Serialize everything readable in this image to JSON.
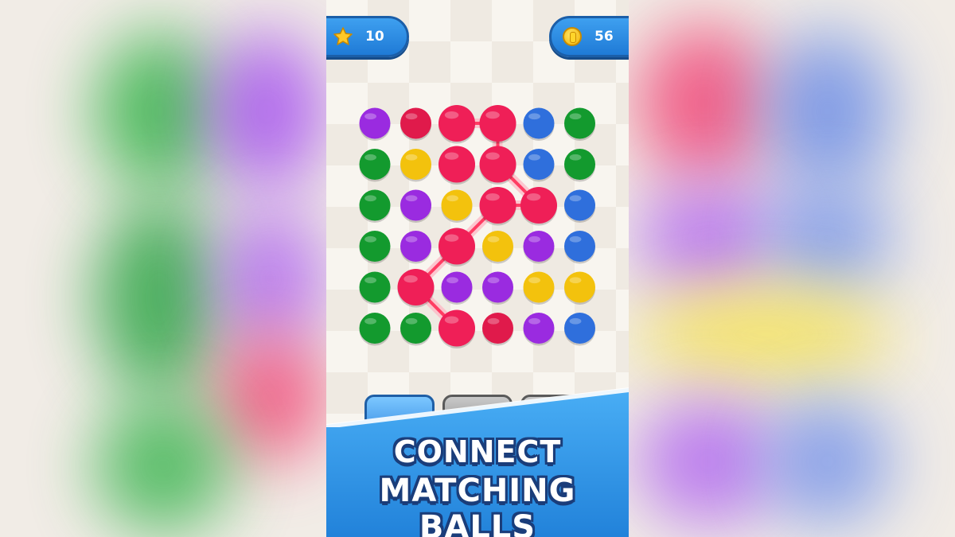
{
  "hud": {
    "stars": "10",
    "coins": "56"
  },
  "headline": {
    "line1": "CONNECT",
    "line2": "MATCHING BALLS"
  },
  "colors": {
    "purple": "#9a2be0",
    "red": "#e01a4b",
    "pink": "#ef1f57",
    "blue": "#2f6fdc",
    "green": "#139a2e",
    "yellow": "#f3c20d",
    "link": "#ff3d63"
  },
  "board": {
    "rows": [
      [
        "purple",
        "red",
        "pink",
        "pink",
        "blue",
        "green"
      ],
      [
        "green",
        "yellow",
        "pink",
        "pink",
        "blue",
        "green"
      ],
      [
        "green",
        "purple",
        "yellow",
        "pink",
        "pink",
        "blue"
      ],
      [
        "green",
        "purple",
        "pink",
        "yellow",
        "purple",
        "blue"
      ],
      [
        "green",
        "pink",
        "purple",
        "purple",
        "yellow",
        "yellow"
      ],
      [
        "green",
        "green",
        "pink",
        "red",
        "purple",
        "blue"
      ]
    ],
    "path": [
      [
        0,
        2
      ],
      [
        0,
        3
      ],
      [
        1,
        3
      ],
      [
        2,
        4
      ],
      [
        2,
        3
      ],
      [
        3,
        2
      ],
      [
        4,
        1
      ],
      [
        5,
        2
      ],
      [
        1,
        2
      ]
    ]
  },
  "icons": {
    "star": "star-icon",
    "coin": "coin-icon"
  }
}
